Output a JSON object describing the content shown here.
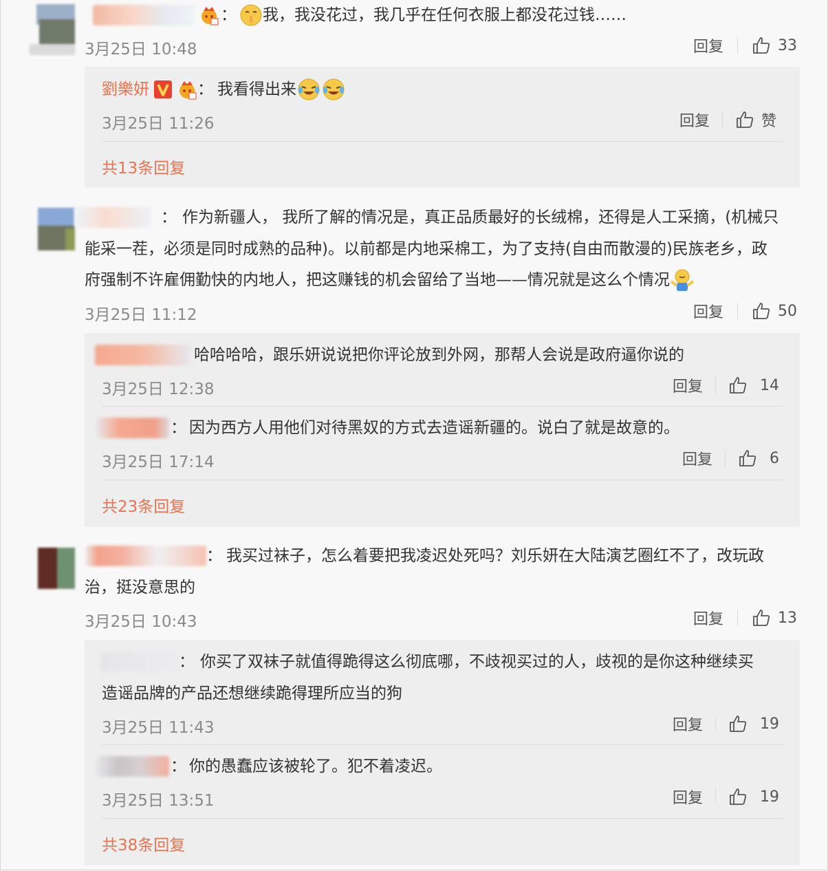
{
  "reply_label": "回复",
  "comments": [
    {
      "text": "我，我没花过，我几乎在任何衣服上都没花过钱……",
      "time": "3月25日 10:48",
      "likes": "33",
      "replies": [
        {
          "name": "劉樂妍",
          "text": "我看得出来",
          "time": "3月25日 11:26",
          "likes": "赞"
        }
      ],
      "total": "共13条回复"
    },
    {
      "text_lines": [
        "作为新疆人， 我所了解的情况是，真正品质最好的长绒棉，还得是人工采摘，(机械只",
        "能采一茬，必须是同时成熟的品种)。以前都是内地采棉工，为了支持(自由而散漫的)民族老乡，政",
        "府强制不许雇佣勤快的内地人，把这赚钱的机会留给了当地——情况就是这么个情况"
      ],
      "time": "3月25日 11:12",
      "likes": "50",
      "replies": [
        {
          "text": "哈哈哈哈，跟乐妍说说把你评论放到外网，那帮人会说是政府逼你说的",
          "time": "3月25日 12:38",
          "likes": "14"
        },
        {
          "text": "因为西方人用他们对待黑奴的方式去造谣新疆的。说白了就是故意的。",
          "time": "3月25日 17:14",
          "likes": "6"
        }
      ],
      "total": "共23条回复"
    },
    {
      "text_lines": [
        "我买过袜子，怎么着要把我凌迟处死吗？刘乐妍在大陆演艺圈红不了，改玩政",
        "治，挺没意思的"
      ],
      "time": "3月25日 10:43",
      "likes": "13",
      "replies": [
        {
          "text_lines": [
            "你买了双袜子就值得跪得这么彻底哪，不歧视买过的人，歧视的是你这种继续买",
            "造谣品牌的产品还想继续跪得理所应当的狗"
          ],
          "time": "3月25日 11:43",
          "likes": "19"
        },
        {
          "text": "你的愚蠢应该被轮了。犯不着凌迟。",
          "time": "3月25日 13:51",
          "likes": "19"
        }
      ],
      "total": "共38条回复"
    }
  ],
  "icons": {
    "like": "thumbs-up-icon",
    "verified": "verified-v-icon",
    "fan_badge": "fan-crown-icon",
    "emoji_shush": "shush-emoji",
    "emoji_laugh": "laugh-cry-emoji",
    "emoji_shrug": "shrug-emoji"
  },
  "colors": {
    "accent": "#eb7350",
    "verified": "#e8412f",
    "subbox": "#eeeeee"
  }
}
